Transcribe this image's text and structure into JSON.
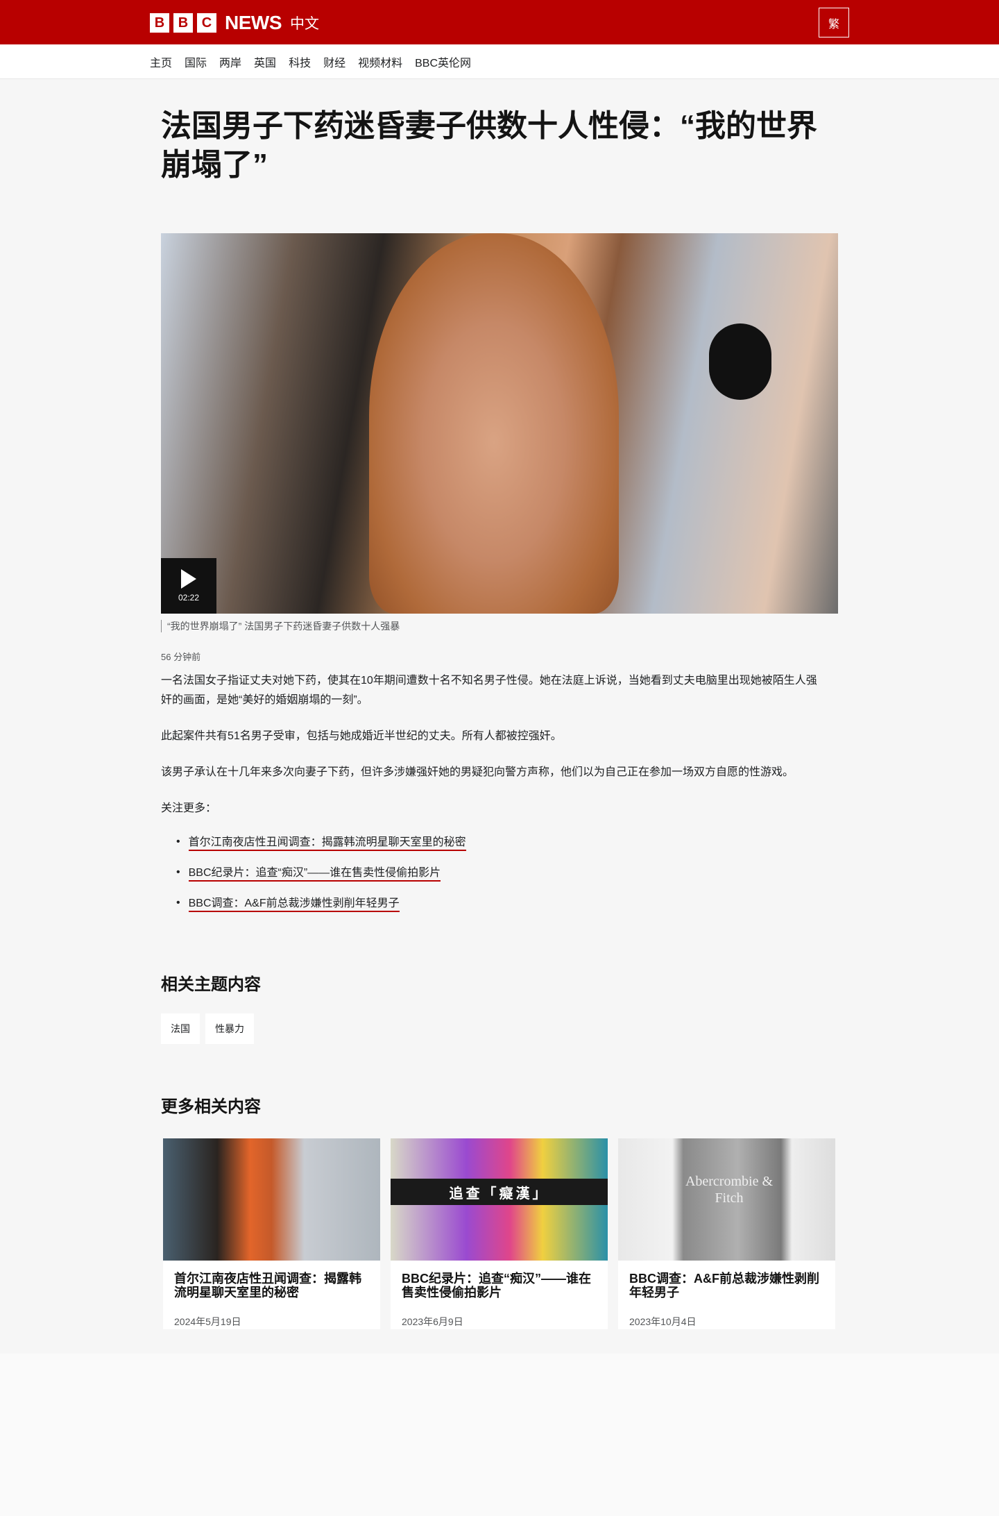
{
  "header": {
    "logo_letters": [
      "B",
      "B",
      "C"
    ],
    "logo_news": "NEWS",
    "logo_lang": "中文",
    "traditional_button": "繁"
  },
  "nav": [
    "主页",
    "国际",
    "两岸",
    "英国",
    "科技",
    "财经",
    "视频材料",
    "BBC英伦网"
  ],
  "article": {
    "title": "法国男子下药迷昏妻子供数十人性侵：“我的世界崩塌了”",
    "video_duration": "02:22",
    "caption": "“我的世界崩塌了” 法国男子下药迷昏妻子供数十人强暴",
    "time": "56 分钟前",
    "paragraphs": [
      "一名法国女子指证丈夫对她下药，使其在10年期间遭数十名不知名男子性侵。她在法庭上诉说，当她看到丈夫电脑里出现她被陌生人强奸的画面，是她“美好的婚姻崩塌的一刻”。",
      "此起案件共有51名男子受审，包括与她成婚近半世纪的丈夫。所有人都被控强奸。",
      "该男子承认在十几年来多次向妻子下药，但许多涉嫌强奸她的男疑犯向警方声称，他们以为自己正在参加一场双方自愿的性游戏。",
      "关注更多："
    ],
    "links": [
      "首尔江南夜店性丑闻调查：揭露韩流明星聊天室里的秘密",
      "BBC纪录片：追查“痴汉”——谁在售卖性侵偷拍影片",
      "BBC调查：A&F前总裁涉嫌性剥削年轻男子"
    ]
  },
  "topics": {
    "heading": "相关主题内容",
    "tags": [
      "法国",
      "性暴力"
    ]
  },
  "related": {
    "heading": "更多相关内容",
    "cards": [
      {
        "title": "首尔江南夜店性丑闻调查：揭露韩流明星聊天室里的秘密",
        "date": "2024年5月19日"
      },
      {
        "title": "BBC纪录片：追查“痴汉”——谁在售卖性侵偷拍影片",
        "date": "2023年6月9日",
        "image_text": "追查「癡漢」"
      },
      {
        "title": "BBC调查：A&F前总裁涉嫌性剥削年轻男子",
        "date": "2023年10月4日",
        "image_text": "Abercrombie & Fitch"
      }
    ]
  },
  "colors": {
    "brand": "#b80000",
    "background": "#f6f6f6"
  }
}
